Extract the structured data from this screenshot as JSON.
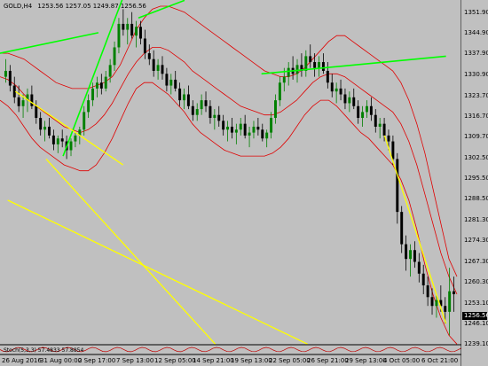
{
  "header": {
    "symbol": "GOLD,H4",
    "ohlc": "1253.56 1257.05 1249.87 1256.56"
  },
  "sub_indicator": {
    "label": "Stoch(5,3,3) 57.4833 57.8854"
  },
  "current_price": "1256.56",
  "price_axis": [
    "1351.90",
    "1344.90",
    "1337.90",
    "1330.90",
    "1323.70",
    "1316.70",
    "1309.70",
    "1302.50",
    "1295.50",
    "1288.50",
    "1281.30",
    "1274.30",
    "1267.30",
    "1260.30",
    "1253.10",
    "1246.10",
    "1239.10"
  ],
  "time_axis": [
    "26 Aug 2016",
    "31 Aug 00:00",
    "2 Sep 17:00",
    "7 Sep 13:00",
    "12 Sep 05:00",
    "14 Sep 21:00",
    "19 Sep 13:00",
    "22 Sep 05:00",
    "26 Sep 21:00",
    "29 Sep 13:00",
    "4 Oct 05:00",
    "6 Oct 21:00"
  ],
  "colors": {
    "background": "#c0c0c0",
    "bull": "#008000",
    "bear": "#000000",
    "bands": "#e00000",
    "green_trend": "#00ff00",
    "yellow_trend": "#ffff00"
  },
  "chart_data": {
    "type": "candlestick",
    "title": "GOLD,H4",
    "ylim": [
      1239.1,
      1351.9
    ],
    "candles": [
      [
        1330,
        1336,
        1328,
        1332
      ],
      [
        1332,
        1334,
        1325,
        1327
      ],
      [
        1327,
        1330,
        1321,
        1323
      ],
      [
        1323,
        1327,
        1318,
        1320
      ],
      [
        1320,
        1324,
        1316,
        1322
      ],
      [
        1322,
        1326,
        1318,
        1324
      ],
      [
        1324,
        1327,
        1319,
        1320
      ],
      [
        1320,
        1322,
        1314,
        1316
      ],
      [
        1316,
        1318,
        1310,
        1312
      ],
      [
        1312,
        1315,
        1308,
        1313
      ],
      [
        1313,
        1316,
        1309,
        1310
      ],
      [
        1310,
        1312,
        1305,
        1307
      ],
      [
        1307,
        1310,
        1304,
        1309
      ],
      [
        1309,
        1312,
        1306,
        1308
      ],
      [
        1308,
        1310,
        1302,
        1305
      ],
      [
        1305,
        1309,
        1303,
        1308
      ],
      [
        1308,
        1311,
        1306,
        1310
      ],
      [
        1310,
        1313,
        1307,
        1312
      ],
      [
        1312,
        1320,
        1310,
        1318
      ],
      [
        1318,
        1324,
        1316,
        1322
      ],
      [
        1322,
        1328,
        1320,
        1326
      ],
      [
        1326,
        1330,
        1323,
        1328
      ],
      [
        1328,
        1331,
        1324,
        1326
      ],
      [
        1326,
        1332,
        1325,
        1330
      ],
      [
        1330,
        1336,
        1328,
        1334
      ],
      [
        1334,
        1342,
        1332,
        1340
      ],
      [
        1340,
        1350,
        1338,
        1348
      ],
      [
        1348,
        1353,
        1344,
        1346
      ],
      [
        1346,
        1350,
        1341,
        1348
      ],
      [
        1348,
        1352,
        1343,
        1344
      ],
      [
        1344,
        1349,
        1340,
        1347
      ],
      [
        1347,
        1349,
        1341,
        1343
      ],
      [
        1343,
        1346,
        1336,
        1338
      ],
      [
        1338,
        1341,
        1334,
        1336
      ],
      [
        1336,
        1339,
        1330,
        1332
      ],
      [
        1332,
        1336,
        1329,
        1334
      ],
      [
        1334,
        1337,
        1329,
        1331
      ],
      [
        1331,
        1333,
        1325,
        1327
      ],
      [
        1327,
        1331,
        1324,
        1329
      ],
      [
        1329,
        1332,
        1325,
        1326
      ],
      [
        1326,
        1328,
        1320,
        1322
      ],
      [
        1322,
        1326,
        1319,
        1324
      ],
      [
        1324,
        1327,
        1319,
        1320
      ],
      [
        1320,
        1322,
        1315,
        1317
      ],
      [
        1317,
        1321,
        1315,
        1319
      ],
      [
        1319,
        1324,
        1317,
        1322
      ],
      [
        1322,
        1325,
        1318,
        1320
      ],
      [
        1320,
        1322,
        1314,
        1316
      ],
      [
        1316,
        1319,
        1312,
        1317
      ],
      [
        1317,
        1320,
        1313,
        1315
      ],
      [
        1315,
        1317,
        1310,
        1312
      ],
      [
        1312,
        1315,
        1308,
        1313
      ],
      [
        1313,
        1316,
        1309,
        1311
      ],
      [
        1311,
        1314,
        1307,
        1312
      ],
      [
        1312,
        1316,
        1310,
        1314
      ],
      [
        1314,
        1317,
        1309,
        1310
      ],
      [
        1310,
        1313,
        1306,
        1311
      ],
      [
        1311,
        1315,
        1309,
        1313
      ],
      [
        1313,
        1316,
        1310,
        1312
      ],
      [
        1312,
        1314,
        1308,
        1309
      ],
      [
        1309,
        1312,
        1306,
        1311
      ],
      [
        1311,
        1318,
        1309,
        1316
      ],
      [
        1316,
        1324,
        1314,
        1322
      ],
      [
        1322,
        1330,
        1320,
        1328
      ],
      [
        1328,
        1333,
        1325,
        1330
      ],
      [
        1330,
        1335,
        1327,
        1333
      ],
      [
        1333,
        1337,
        1329,
        1331
      ],
      [
        1331,
        1336,
        1328,
        1334
      ],
      [
        1334,
        1338,
        1330,
        1332
      ],
      [
        1332,
        1339,
        1330,
        1337
      ],
      [
        1337,
        1341,
        1333,
        1335
      ],
      [
        1335,
        1338,
        1330,
        1333
      ],
      [
        1333,
        1337,
        1330,
        1335
      ],
      [
        1335,
        1338,
        1331,
        1332
      ],
      [
        1332,
        1335,
        1326,
        1328
      ],
      [
        1328,
        1331,
        1323,
        1325
      ],
      [
        1325,
        1328,
        1321,
        1326
      ],
      [
        1326,
        1329,
        1322,
        1324
      ],
      [
        1324,
        1326,
        1319,
        1321
      ],
      [
        1321,
        1325,
        1318,
        1323
      ],
      [
        1323,
        1326,
        1319,
        1320
      ],
      [
        1320,
        1322,
        1314,
        1316
      ],
      [
        1316,
        1320,
        1313,
        1318
      ],
      [
        1318,
        1322,
        1316,
        1320
      ],
      [
        1320,
        1323,
        1315,
        1317
      ],
      [
        1317,
        1319,
        1311,
        1313
      ],
      [
        1313,
        1316,
        1309,
        1314
      ],
      [
        1314,
        1316,
        1308,
        1310
      ],
      [
        1310,
        1312,
        1305,
        1308
      ],
      [
        1308,
        1310,
        1300,
        1302
      ],
      [
        1302,
        1304,
        1280,
        1284
      ],
      [
        1284,
        1286,
        1270,
        1273
      ],
      [
        1273,
        1276,
        1264,
        1268
      ],
      [
        1268,
        1273,
        1262,
        1271
      ],
      [
        1271,
        1274,
        1265,
        1267
      ],
      [
        1267,
        1270,
        1260,
        1263
      ],
      [
        1263,
        1266,
        1256,
        1259
      ],
      [
        1259,
        1262,
        1252,
        1255
      ],
      [
        1255,
        1258,
        1249,
        1252
      ],
      [
        1252,
        1256,
        1248,
        1254
      ],
      [
        1254,
        1259,
        1250,
        1252
      ],
      [
        1252,
        1255,
        1246,
        1250
      ],
      [
        1250,
        1265,
        1242,
        1257
      ],
      [
        1257,
        1262,
        1250,
        1256
      ]
    ],
    "bollinger": {
      "upper": [
        1338,
        1338,
        1337,
        1336,
        1334,
        1332,
        1330,
        1328,
        1327,
        1326,
        1326,
        1326,
        1327,
        1328,
        1330,
        1334,
        1340,
        1346,
        1350,
        1353,
        1354,
        1354,
        1353,
        1352,
        1350,
        1348,
        1346,
        1344,
        1342,
        1340,
        1338,
        1336,
        1334,
        1332,
        1331,
        1330,
        1330,
        1331,
        1333,
        1336,
        1339,
        1342,
        1344,
        1344,
        1342,
        1340,
        1338,
        1336,
        1334,
        1332,
        1328,
        1322,
        1314,
        1304,
        1292,
        1280,
        1268,
        1262
      ],
      "middle": [
        1330,
        1329,
        1327,
        1324,
        1321,
        1319,
        1317,
        1315,
        1313,
        1312,
        1311,
        1312,
        1314,
        1317,
        1321,
        1326,
        1331,
        1335,
        1338,
        1340,
        1340,
        1339,
        1337,
        1335,
        1332,
        1330,
        1328,
        1326,
        1324,
        1322,
        1320,
        1319,
        1318,
        1317,
        1317,
        1318,
        1320,
        1322,
        1325,
        1328,
        1330,
        1331,
        1331,
        1330,
        1328,
        1326,
        1324,
        1322,
        1320,
        1318,
        1314,
        1308,
        1300,
        1290,
        1280,
        1270,
        1262,
        1256
      ],
      "lower": [
        1322,
        1320,
        1317,
        1313,
        1309,
        1306,
        1304,
        1302,
        1300,
        1299,
        1298,
        1298,
        1300,
        1304,
        1309,
        1315,
        1321,
        1326,
        1328,
        1328,
        1326,
        1324,
        1321,
        1318,
        1314,
        1311,
        1309,
        1307,
        1305,
        1304,
        1303,
        1303,
        1303,
        1303,
        1304,
        1306,
        1309,
        1313,
        1317,
        1320,
        1322,
        1322,
        1320,
        1317,
        1314,
        1311,
        1309,
        1306,
        1303,
        1300,
        1295,
        1288,
        1278,
        1266,
        1256,
        1248,
        1242,
        1239
      ]
    },
    "trendlines": [
      {
        "color": "green",
        "from": [
          0,
          1338
        ],
        "to": [
          64,
          1345
        ]
      },
      {
        "color": "green",
        "from": [
          41,
          1303
        ],
        "to": [
          80,
          1357
        ]
      },
      {
        "color": "green",
        "from": [
          90,
          1350
        ],
        "to": [
          120,
          1356
        ]
      },
      {
        "color": "green",
        "from": [
          170,
          1331
        ],
        "to": [
          290,
          1337
        ]
      },
      {
        "color": "yellow",
        "from": [
          10,
          1325
        ],
        "to": [
          80,
          1300
        ]
      },
      {
        "color": "yellow",
        "from": [
          5,
          1288
        ],
        "to": [
          200,
          1239
        ]
      },
      {
        "color": "yellow",
        "from": [
          30,
          1302
        ],
        "to": [
          140,
          1239
        ]
      },
      {
        "color": "yellow",
        "from": [
          250,
          1310
        ],
        "to": [
          290,
          1246
        ]
      }
    ]
  }
}
